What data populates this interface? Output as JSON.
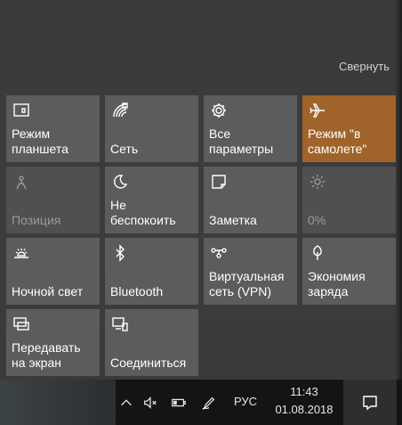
{
  "action_center": {
    "collapse_label": "Свернуть",
    "tiles": [
      {
        "id": "tablet-mode",
        "label": "Режим\nпланшета",
        "icon": "tablet-mode-icon",
        "state": "off"
      },
      {
        "id": "network",
        "label": "Сеть",
        "icon": "network-icon",
        "state": "off"
      },
      {
        "id": "all-settings",
        "label": "Все\nпараметры",
        "icon": "gear-icon",
        "state": "off"
      },
      {
        "id": "airplane-mode",
        "label": "Режим \"в\nсамолете\"",
        "icon": "airplane-icon",
        "state": "on"
      },
      {
        "id": "location",
        "label": "Позиция",
        "icon": "location-icon",
        "state": "disabled"
      },
      {
        "id": "quiet-hours",
        "label": "Не\nбеспокоить",
        "icon": "moon-icon",
        "state": "off"
      },
      {
        "id": "note",
        "label": "Заметка",
        "icon": "note-icon",
        "state": "off"
      },
      {
        "id": "brightness",
        "label": "0%",
        "icon": "brightness-icon",
        "state": "disabled"
      },
      {
        "id": "night-light",
        "label": "Ночной свет",
        "icon": "night-light-icon",
        "state": "off"
      },
      {
        "id": "bluetooth",
        "label": "Bluetooth",
        "icon": "bluetooth-icon",
        "state": "off"
      },
      {
        "id": "vpn",
        "label": "Виртуальная\nсеть (VPN)",
        "icon": "vpn-icon",
        "state": "off"
      },
      {
        "id": "battery-saver",
        "label": "Экономия\nзаряда",
        "icon": "leaf-icon",
        "state": "off"
      },
      {
        "id": "project",
        "label": "Передавать\nна экран",
        "icon": "project-icon",
        "state": "off"
      },
      {
        "id": "connect",
        "label": "Соединиться",
        "icon": "connect-icon",
        "state": "off"
      }
    ]
  },
  "taskbar": {
    "language": "РУС",
    "time": "11:43",
    "date": "01.08.2018",
    "tray_icons": [
      "chevron-up-icon",
      "volume-muted-icon",
      "battery-icon",
      "pen-icon"
    ]
  },
  "colors": {
    "tile": "#5c5c5c",
    "tile_active": "#a0642a",
    "tile_disabled": "#505050",
    "panel": "#3b3b3b",
    "taskbar": "#141414"
  }
}
